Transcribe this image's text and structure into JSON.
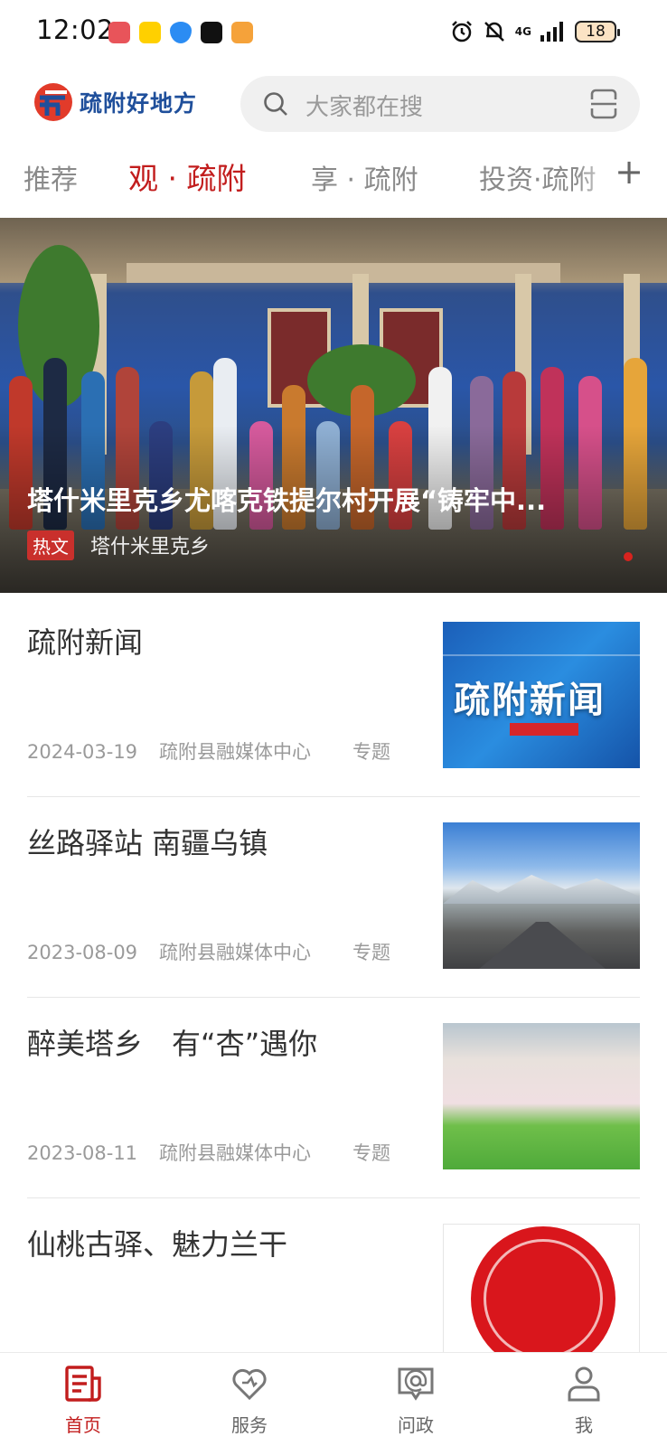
{
  "status_bar": {
    "time": "12:02",
    "battery": "18",
    "network": "4G"
  },
  "header": {
    "brand": "疏附好地方",
    "search_placeholder": "大家都在搜"
  },
  "tabs": [
    {
      "label": "推荐",
      "active": false
    },
    {
      "label": "观 · 疏附",
      "active": true
    },
    {
      "label": "享 · 疏附",
      "active": false
    },
    {
      "label": "投资·疏附",
      "active": false
    }
  ],
  "tabs_more": "+",
  "hero": {
    "title": "塔什米里克乡尤喀克铁提尔村开展“铸牢中...",
    "tag": "热文",
    "source": "塔什米里克乡"
  },
  "news": [
    {
      "title": "疏附新闻",
      "date": "2024-03-19",
      "source": "疏附县融媒体中心",
      "type": "专题",
      "thumb_text": "疏附新闻"
    },
    {
      "title": "丝路驿站 南疆乌镇",
      "date": "2023-08-09",
      "source": "疏附县融媒体中心",
      "type": "专题"
    },
    {
      "title": "醉美塔乡　有“杏”遇你",
      "date": "2023-08-11",
      "source": "疏附县融媒体中心",
      "type": "专题"
    },
    {
      "title": "仙桃古驿、魅力兰干"
    }
  ],
  "bottom_nav": [
    {
      "label": "首页",
      "active": true
    },
    {
      "label": "服务",
      "active": false
    },
    {
      "label": "问政",
      "active": false
    },
    {
      "label": "我",
      "active": false
    }
  ],
  "colors": {
    "accent": "#c21d1d",
    "brand_blue": "#1f4f9b"
  }
}
